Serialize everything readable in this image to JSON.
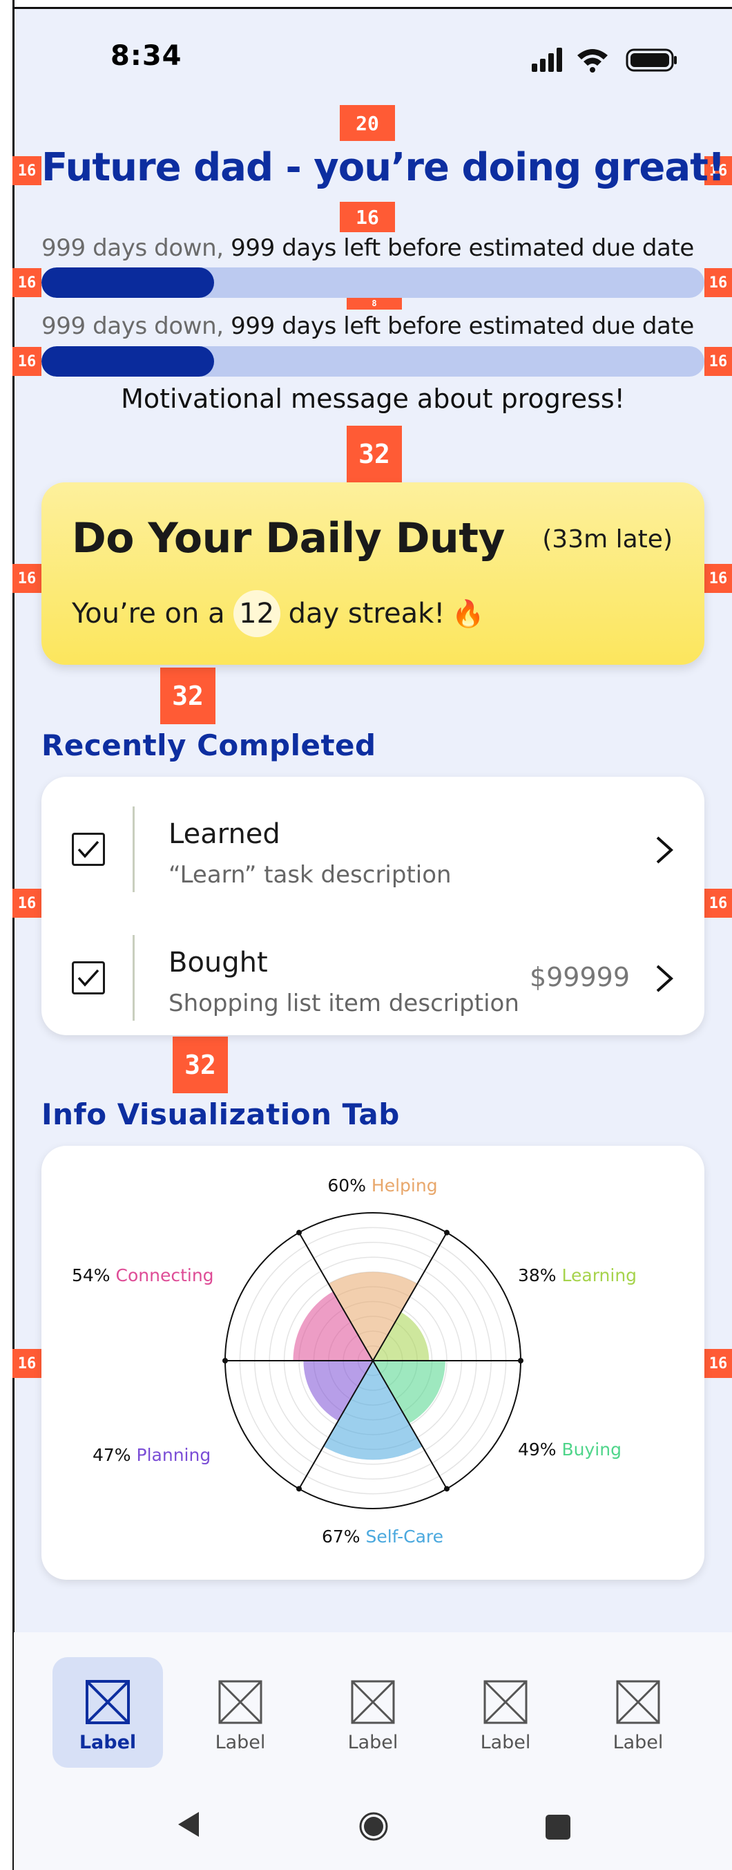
{
  "status_bar": {
    "time": "8:34"
  },
  "spacing_badges": {
    "title_gap": "20",
    "side": "16",
    "subtitle_gap": "16",
    "bar_gap": "8",
    "section_gap": "32"
  },
  "header": {
    "title": "Future dad - you’re doing great!"
  },
  "progress": [
    {
      "down_text": "999 days down,",
      "left_text": "999 days left before estimated due date",
      "fraction": 0.26
    },
    {
      "down_text": "999 days down,",
      "left_text": "999 days left before estimated due date",
      "fraction": 0.26
    }
  ],
  "motivation": "Motivational message about progress!",
  "daily_duty": {
    "title": "Do Your Daily Duty",
    "late": "(33m late)",
    "streak_prefix": "You’re on a",
    "streak_count": "12",
    "streak_suffix": "day streak!",
    "streak_emoji": "🔥"
  },
  "recently_completed": {
    "heading": "Recently Completed",
    "items": [
      {
        "title": "Learned",
        "description": "“Learn” task description",
        "price": "",
        "checked": true
      },
      {
        "title": "Bought",
        "description": "Shopping list item description",
        "price": "$99999",
        "checked": true
      }
    ]
  },
  "info_tab": {
    "heading": "Info Visualization Tab"
  },
  "chart_data": {
    "type": "polar-area",
    "scale": [
      0,
      100
    ],
    "categories": [
      {
        "label": "Helping",
        "value": 60,
        "color": "#e8a76b"
      },
      {
        "label": "Learning",
        "value": 38,
        "color": "#a6d34c"
      },
      {
        "label": "Buying",
        "value": 49,
        "color": "#4fd58a"
      },
      {
        "label": "Self-Care",
        "value": 67,
        "color": "#4aa8de"
      },
      {
        "label": "Planning",
        "value": 47,
        "color": "#7b4ed6"
      },
      {
        "label": "Connecting",
        "value": 54,
        "color": "#de4c96"
      }
    ]
  },
  "bottom_nav": {
    "items": [
      {
        "label": "Label",
        "active": true
      },
      {
        "label": "Label",
        "active": false
      },
      {
        "label": "Label",
        "active": false
      },
      {
        "label": "Label",
        "active": false
      },
      {
        "label": "Label",
        "active": false
      }
    ]
  },
  "colors": {
    "primary": "#0d2ea0",
    "progress_track": "#bccaf0",
    "background": "#ecf0fb",
    "badge": "#ff5b35"
  }
}
